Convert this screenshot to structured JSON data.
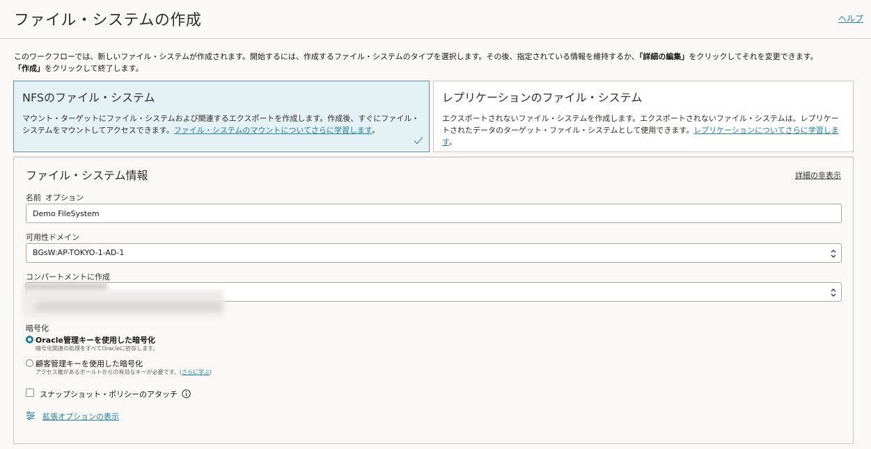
{
  "header": {
    "title": "ファイル・システムの作成",
    "help_label": "ヘルプ"
  },
  "intro": {
    "text_1": "このワークフローでは、新しいファイル・システムが作成されます。開始するには、作成するファイル・システムのタイプを選択します。その後、指定されている情報を維持するか、",
    "edit_details": "「詳細の編集」",
    "text_2": "をクリックしてそれを変更できます。",
    "create": "「作成」",
    "text_3": "をクリックして終了します。"
  },
  "cards": {
    "nfs": {
      "title": "NFSのファイル・システム",
      "desc": "マウント・ターゲットにファイル・システムおよび関連するエクスポートを作成します。作成後、すぐにファイル・システムをマウントしてアクセスできます。",
      "link": "ファイル・システムのマウントについてさらに学習します",
      "suffix": "。",
      "selected": true
    },
    "replication": {
      "title": "レプリケーションのファイル・システム",
      "desc": "エクスポートされないファイル・システムを作成します。エクスポートされないファイル・システムは、レプリケートされたデータのターゲット・ファイル・システムとして使用できます。",
      "link": "レプリケーションについてさらに学習します",
      "suffix": "。",
      "selected": false
    }
  },
  "file_system_info": {
    "title": "ファイル・システム情報",
    "hide_details": "詳細の非表示",
    "name": {
      "label": "名前",
      "optional": "オプション",
      "value": "Demo FileSystem"
    },
    "availability_domain": {
      "label": "可用性ドメイン",
      "value": "BGsW:AP-TOKYO-1-AD-1"
    },
    "compartment": {
      "label": "コンパートメントに作成"
    },
    "encryption": {
      "label": "暗号化",
      "oracle": {
        "label": "Oracle管理キーを使用した暗号化",
        "help": "暗号化関連の処理をすべてOracleに依存します。",
        "checked": true
      },
      "customer": {
        "label": "顧客管理キーを使用した暗号化",
        "help": "アクセス権があるボールトからの有効なキーが必要です。(",
        "help_link": "さらに学ぶ",
        "help_suffix": ")",
        "checked": false
      }
    },
    "snapshot_policy": {
      "label": "スナップショット・ポリシーのアタッチ",
      "checked": false
    },
    "advanced_options": "拡張オプションの表示"
  },
  "colors": {
    "accent": "#227e9e",
    "selected_card_bg": "#e4f1f5"
  }
}
